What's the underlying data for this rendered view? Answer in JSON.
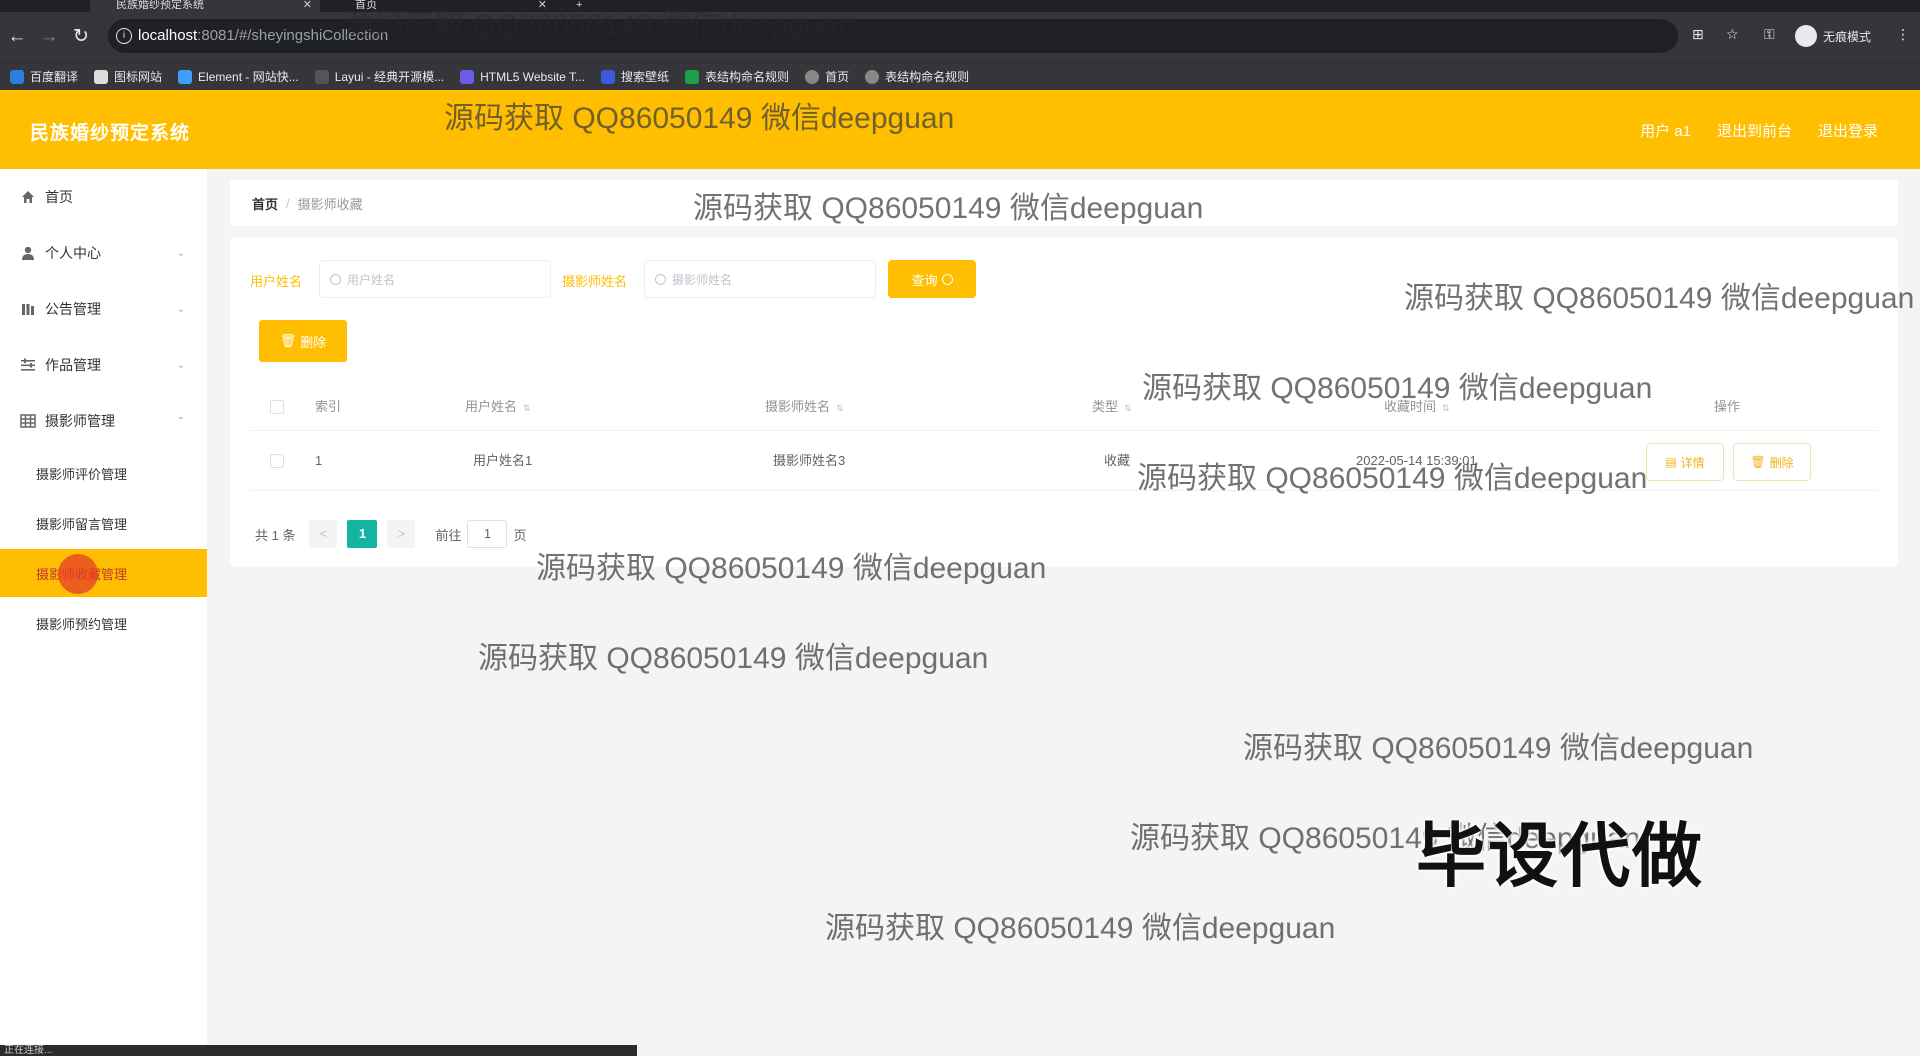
{
  "browser": {
    "tabs": [
      {
        "label": "民族婚纱预定系统",
        "active": true
      },
      {
        "label": "首页",
        "active": false
      }
    ],
    "new_tab": "+",
    "url_host": "localhost",
    "url_path": ":8081/#/sheyingshiCollection",
    "incognito_label": "无痕模式",
    "bookmarks": [
      "百度翻译",
      "图标网站",
      "Element - 网站快...",
      "Layui - 经典开源模...",
      "HTML5 Website T...",
      "搜索壁纸",
      "表结构命名规则",
      "首页",
      "表结构命名规则"
    ]
  },
  "header": {
    "title": "民族婚纱预定系统",
    "user_label": "用户 a1",
    "back_label": "退出到前台",
    "logout_label": "退出登录",
    "accent_color": "#ffbf00"
  },
  "sidebar": {
    "items": [
      {
        "label": "首页",
        "icon": "home-icon"
      },
      {
        "label": "个人中心",
        "icon": "user-icon"
      },
      {
        "label": "公告管理",
        "icon": "bar-chart-icon"
      },
      {
        "label": "作品管理",
        "icon": "sliders-icon"
      },
      {
        "label": "摄影师管理",
        "icon": "grid-icon"
      }
    ],
    "sub_items": [
      "摄影师评价管理",
      "摄影师留言管理",
      "摄影师收藏管理",
      "摄影师预约管理"
    ],
    "active_sub": "摄影师收藏管理"
  },
  "breadcrumb": {
    "home": "首页",
    "sep": "/",
    "current": "摄影师收藏"
  },
  "search": {
    "user_label": "用户姓名",
    "user_placeholder": "用户姓名",
    "photographer_label": "摄影师姓名",
    "photographer_placeholder": "摄影师姓名",
    "query_label": "查询"
  },
  "toolbar": {
    "delete_label": "删除"
  },
  "table": {
    "columns": [
      "索引",
      "用户姓名",
      "摄影师姓名",
      "类型",
      "收藏时间",
      "操作"
    ],
    "rows": [
      {
        "index": "1",
        "user": "用户姓名1",
        "photographer": "摄影师姓名3",
        "type": "收藏",
        "time": "2022-05-14 15:39:01",
        "detail": "详情",
        "delete": "删除"
      }
    ]
  },
  "pagination": {
    "total": "共 1 条",
    "prev": "<",
    "page": "1",
    "next": ">",
    "goto": "前往",
    "goto_value": "1",
    "page_unit": "页"
  },
  "watermarks": [
    "源码获取 QQ86050149 微信deepguan",
    "毕设代做"
  ],
  "status_bar": "正在连接..."
}
